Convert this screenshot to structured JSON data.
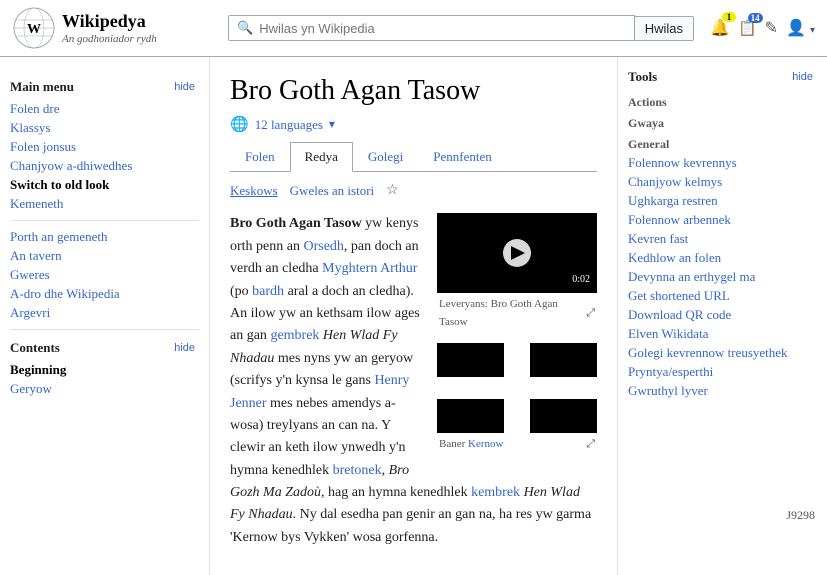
{
  "site": {
    "name": "Wikipedya",
    "tagline": "An godhoniador rydh"
  },
  "search": {
    "placeholder": "Hwilas yn Wikipedia",
    "button_label": "Hwilas"
  },
  "header": {
    "icons": [
      {
        "name": "alerts-icon",
        "glyph": "🔔",
        "badge": "1"
      },
      {
        "name": "watchlist-icon",
        "glyph": "📋",
        "badge": "14"
      },
      {
        "name": "contributions-icon",
        "glyph": "✎",
        "badge": ""
      },
      {
        "name": "user-icon",
        "glyph": "👤",
        "badge": ""
      }
    ]
  },
  "sidebar": {
    "main_menu_label": "Main menu",
    "hide_label": "hide",
    "nav_items": [
      {
        "label": "Folen dre",
        "bold": false
      },
      {
        "label": "Klassys",
        "bold": false
      },
      {
        "label": "Folen jonsus",
        "bold": false
      },
      {
        "label": "Chanjyow a-dhiwedhes",
        "bold": false
      },
      {
        "label": "Switch to old look",
        "bold": true
      },
      {
        "label": "Kemeneth",
        "bold": false
      }
    ],
    "nav_items2": [
      {
        "label": "Porth an gemeneth"
      },
      {
        "label": "An tavern"
      },
      {
        "label": "Gweres"
      },
      {
        "label": "A-dro dhe Wikipedia"
      },
      {
        "label": "Argevri"
      }
    ],
    "contents_label": "Contents",
    "contents_items": [
      {
        "label": "Beginning"
      },
      {
        "label": "Geryow"
      }
    ]
  },
  "page": {
    "title": "Bro Goth Agan Tasow",
    "lang_count": "12 languages",
    "tabs": [
      {
        "label": "Folen",
        "active": false
      },
      {
        "label": "Redya",
        "active": true
      },
      {
        "label": "Golegi",
        "active": false
      },
      {
        "label": "Pennfenten",
        "active": false
      }
    ],
    "subtabs": [
      {
        "label": "Keskows"
      },
      {
        "label": "Gweles an istori"
      },
      {
        "label": "★"
      }
    ],
    "article_text_1": "Bro Goth Agan Tasow",
    "article_text_2": " yw kenys orth penn an ",
    "article_link_1": "Orsedh",
    "article_text_3": ", pan doch an verdh an cledha ",
    "article_link_2": "Myghtern Arthur",
    "article_text_4": " (po ",
    "article_link_3": "bardh",
    "article_text_5": " aral a doch an cledha). An ilow yw an kethsam ilow ages an gan ",
    "article_link_4": "gembrek",
    "article_italic_1": "Hen Wlad Fy Nhadau",
    "article_text_6": " mes nyns yw an geryow (scrifys y'n kynsa le gans ",
    "article_link_5": "Henry Jenner",
    "article_text_7": " mes nebes amendys a-wosa) treylyans an can na. Y clewir an keth ilow ynwedh y'n hymna kenedhlek ",
    "article_link_6": "bretonek",
    "article_italic_2": "Bro Gozh Ma Zadoù",
    "article_text_8": ", hag an hymna kenedhlek ",
    "article_link_7": "kembrek",
    "article_italic_3": "Hen Wlad Fy Nhadau",
    "article_text_9": ". Ny dal esedha pan genir an gan na, ha res yw garma 'Kernow bys Vykken' wosa gorfenna.",
    "video": {
      "caption": "Leveryans: Bro Goth Agan Tasow",
      "duration": "0:02"
    },
    "image": {
      "caption": "Baner Kernow"
    }
  },
  "tools": {
    "title": "Tools",
    "hide_label": "hide",
    "sections": [
      {
        "label": "Actions",
        "items": []
      },
      {
        "label": "Gwaya",
        "items": []
      },
      {
        "label": "General",
        "items": []
      }
    ],
    "links": [
      {
        "label": "Folennow kevrennys"
      },
      {
        "label": "Chanjyow kelmys"
      },
      {
        "label": "Ughkarga restren"
      },
      {
        "label": "Folennow arbennek"
      },
      {
        "label": "Kevren fast"
      },
      {
        "label": "Kedhlow an folen"
      },
      {
        "label": "Devynna an erthygel ma"
      },
      {
        "label": "Get shortened URL"
      },
      {
        "label": "Download QR code"
      },
      {
        "label": "Elven Wikidata"
      },
      {
        "label": "Golegi kevrennow treusyethek"
      },
      {
        "label": "Pryntya/esperthi"
      },
      {
        "label": "Gwruthyl lyver"
      }
    ]
  },
  "footer": {
    "page_number": "J9298"
  }
}
